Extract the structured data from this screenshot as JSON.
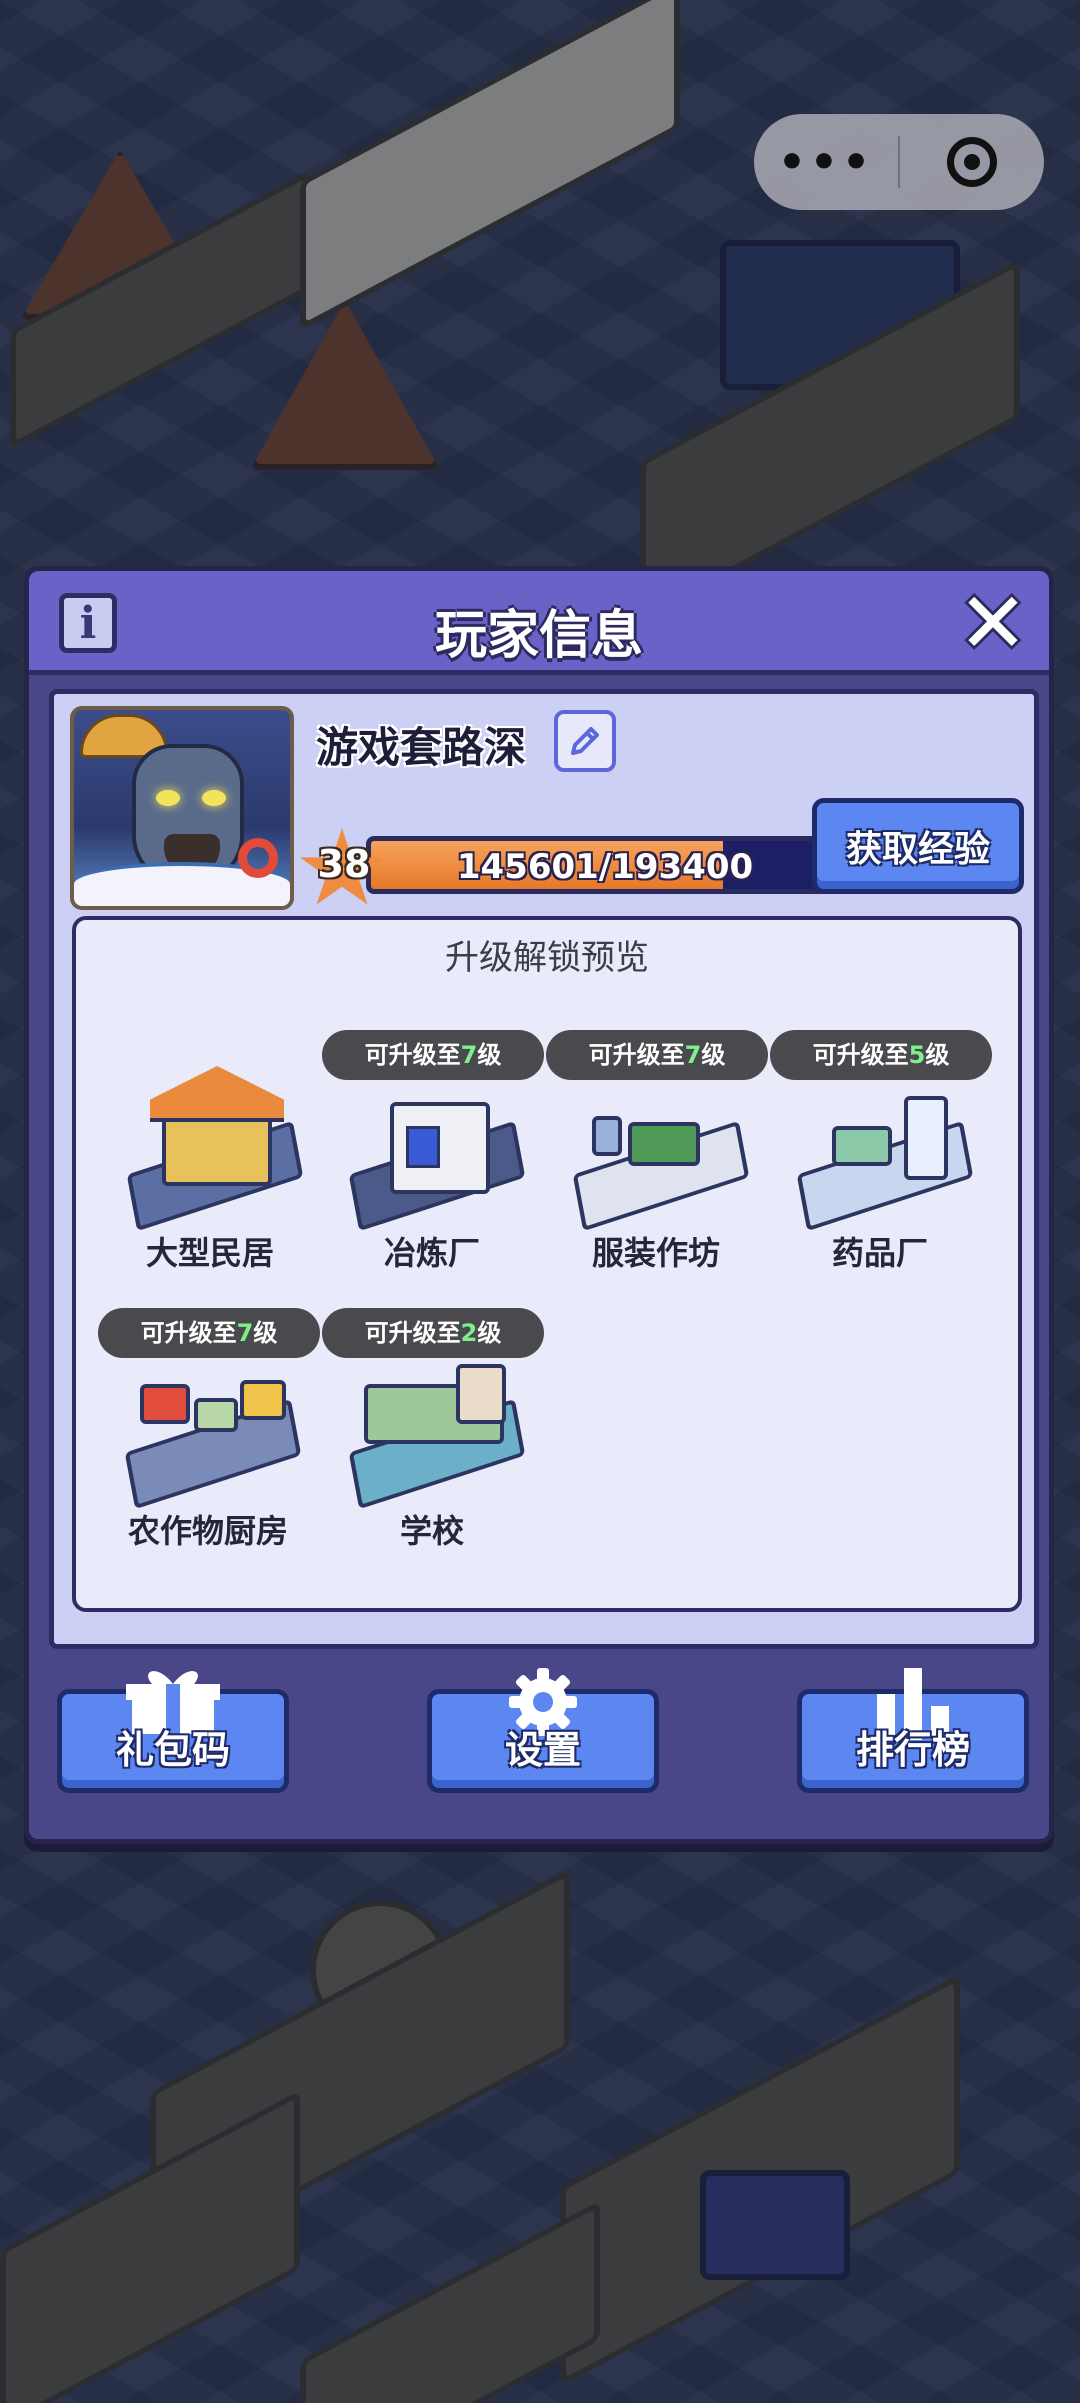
{
  "dialog": {
    "title": "玩家信息",
    "info_icon": "i",
    "close_icon": "✕"
  },
  "player": {
    "name": "游戏套路深",
    "level": "38",
    "xp_text": "145601/193400",
    "xp_progress": 0.753,
    "get_exp_label": "获取经验"
  },
  "preview": {
    "title": "升级解锁预览",
    "buildings": [
      {
        "name": "大型民居",
        "badge_prefix": "",
        "badge_level": "",
        "badge_suffix": ""
      },
      {
        "name": "冶炼厂",
        "badge_prefix": "可升级至",
        "badge_level": "7",
        "badge_suffix": "级"
      },
      {
        "name": "服装作坊",
        "badge_prefix": "可升级至",
        "badge_level": "7",
        "badge_suffix": "级"
      },
      {
        "name": "药品厂",
        "badge_prefix": "可升级至",
        "badge_level": "5",
        "badge_suffix": "级"
      },
      {
        "name": "农作物厨房",
        "badge_prefix": "可升级至",
        "badge_level": "7",
        "badge_suffix": "级"
      },
      {
        "name": "学校",
        "badge_prefix": "可升级至",
        "badge_level": "2",
        "badge_suffix": "级"
      }
    ]
  },
  "actions": {
    "gift_code": "礼包码",
    "settings": "设置",
    "ranking": "排行榜"
  },
  "icons": {
    "info": "info-icon",
    "close": "close-icon",
    "edit": "pencil-icon",
    "star": "star-icon",
    "gift": "gift-icon",
    "gear": "gear-icon",
    "chart": "bar-chart-icon"
  },
  "colors": {
    "title_bar": "#6a63c7",
    "dialog": "#4a4788",
    "button": "#5c86f0",
    "xp_fill": "#e5792a",
    "badge_level": "#7df08a"
  }
}
